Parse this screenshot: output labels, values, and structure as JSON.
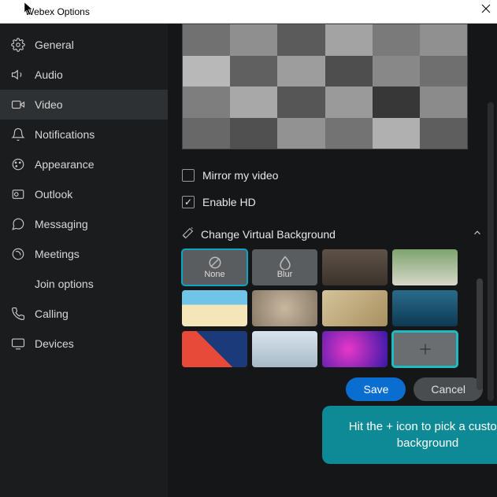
{
  "window": {
    "title": "Webex Options"
  },
  "sidebar": {
    "items": [
      {
        "label": "General"
      },
      {
        "label": "Audio"
      },
      {
        "label": "Video"
      },
      {
        "label": "Notifications"
      },
      {
        "label": "Appearance"
      },
      {
        "label": "Outlook"
      },
      {
        "label": "Messaging"
      },
      {
        "label": "Meetings"
      },
      {
        "label": "Join options"
      },
      {
        "label": "Calling"
      },
      {
        "label": "Devices"
      }
    ]
  },
  "video": {
    "mirror_label": "Mirror my video",
    "mirror_checked": false,
    "hd_label": "Enable HD",
    "hd_checked": true,
    "bg_section_label": "Change Virtual Background",
    "bg_none_label": "None",
    "bg_blur_label": "Blur"
  },
  "callout": {
    "text": "Hit the + icon to pick a custom background"
  },
  "footer": {
    "save_label": "Save",
    "cancel_label": "Cancel"
  }
}
